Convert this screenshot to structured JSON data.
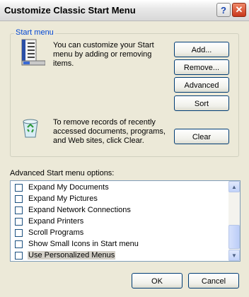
{
  "window": {
    "title": "Customize Classic Start Menu"
  },
  "titlebar": {
    "help_glyph": "?",
    "close_glyph": "✕"
  },
  "group": {
    "label": "Start menu"
  },
  "customize_text": "You can customize your Start menu by adding or removing items.",
  "clear_text": "To remove records of recently accessed documents, programs, and Web sites, click Clear.",
  "buttons": {
    "add": "Add...",
    "remove": "Remove...",
    "advanced": "Advanced",
    "sort": "Sort",
    "clear": "Clear",
    "ok": "OK",
    "cancel": "Cancel"
  },
  "options_label": "Advanced Start menu options:",
  "options": [
    {
      "label": "Expand My Documents",
      "checked": false,
      "selected": false
    },
    {
      "label": "Expand My Pictures",
      "checked": false,
      "selected": false
    },
    {
      "label": "Expand Network Connections",
      "checked": false,
      "selected": false
    },
    {
      "label": "Expand Printers",
      "checked": false,
      "selected": false
    },
    {
      "label": "Scroll Programs",
      "checked": false,
      "selected": false
    },
    {
      "label": "Show Small Icons in Start menu",
      "checked": false,
      "selected": false
    },
    {
      "label": "Use Personalized Menus",
      "checked": false,
      "selected": true
    }
  ],
  "scrollbar": {
    "up_glyph": "▲",
    "down_glyph": "▼"
  },
  "icons": {
    "start_menu": "start-menu-icon",
    "recycle_bin": "recycle-bin-icon"
  }
}
